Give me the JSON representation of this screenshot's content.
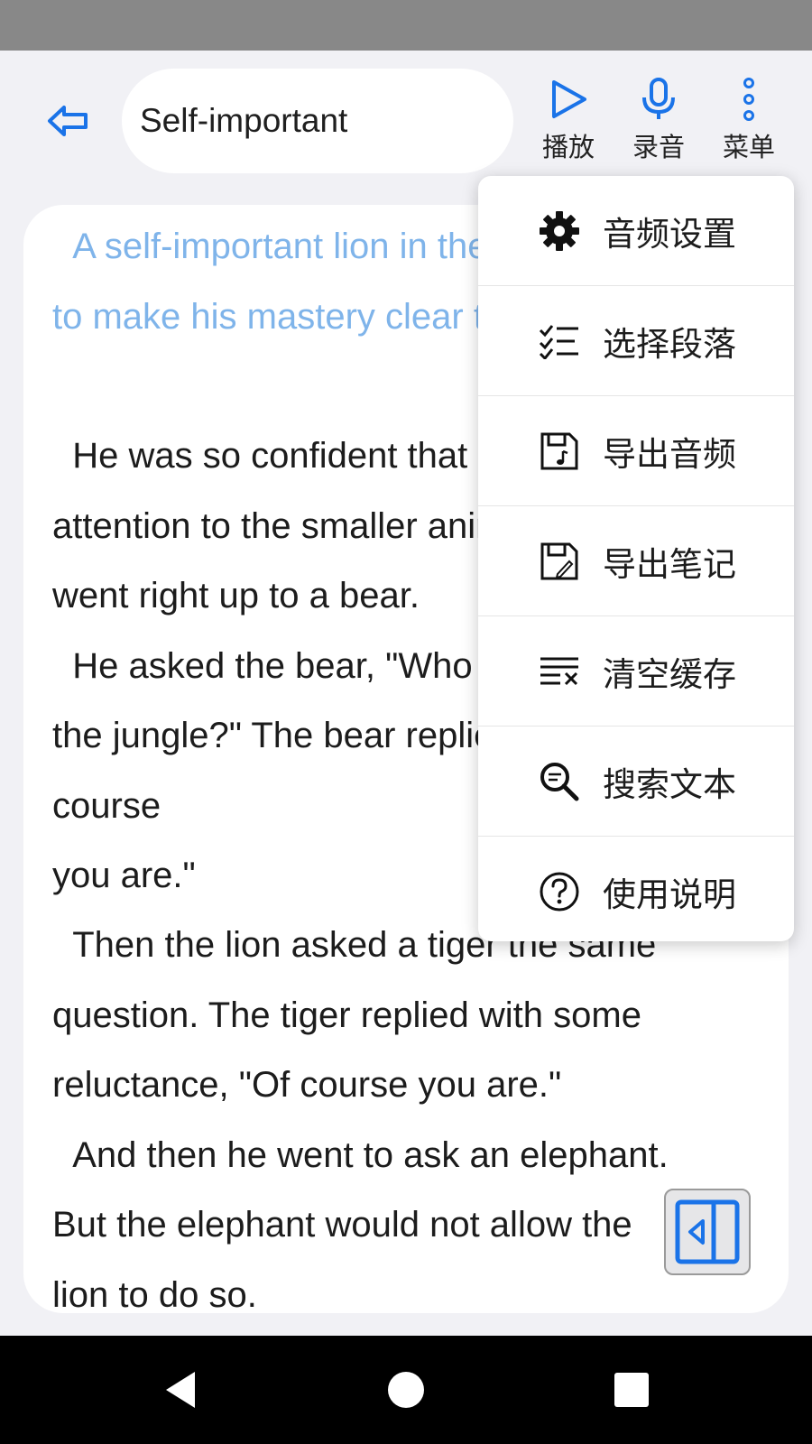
{
  "header": {
    "title": "Self-important",
    "play_label": "播放",
    "record_label": "录音",
    "menu_label": "菜单"
  },
  "content": {
    "paragraphs": [
      "  A self-important lion in the jungle wanted\nto make his mastery clear to everyone.",
      "  He was so confident that he paid no\nattention to the smaller animals. Instead he\nwent right up to a bear.\n  He asked the bear, \"Who is the king of\nthe jungle?\" The bear replied, \"Why, of course\nyou are.\"",
      "  Then the lion asked a tiger the same\nquestion. The tiger replied with some\nreluctance, \"Of course you are.\"\n  And then he went to ask an elephant.\nBut the elephant would not allow the\nlion to do so."
    ]
  },
  "menu": {
    "items": [
      {
        "label": "音频设置",
        "icon": "gear-icon"
      },
      {
        "label": "选择段落",
        "icon": "checklist-icon"
      },
      {
        "label": "导出音频",
        "icon": "save-audio-icon"
      },
      {
        "label": "导出笔记",
        "icon": "save-note-icon"
      },
      {
        "label": "清空缓存",
        "icon": "clear-cache-icon"
      },
      {
        "label": "搜索文本",
        "icon": "search-text-icon"
      },
      {
        "label": "使用说明",
        "icon": "help-icon"
      }
    ]
  },
  "colors": {
    "accent": "#1a73e8",
    "highlight_text": "#7fb4ea",
    "background": "#f1f1f5"
  }
}
